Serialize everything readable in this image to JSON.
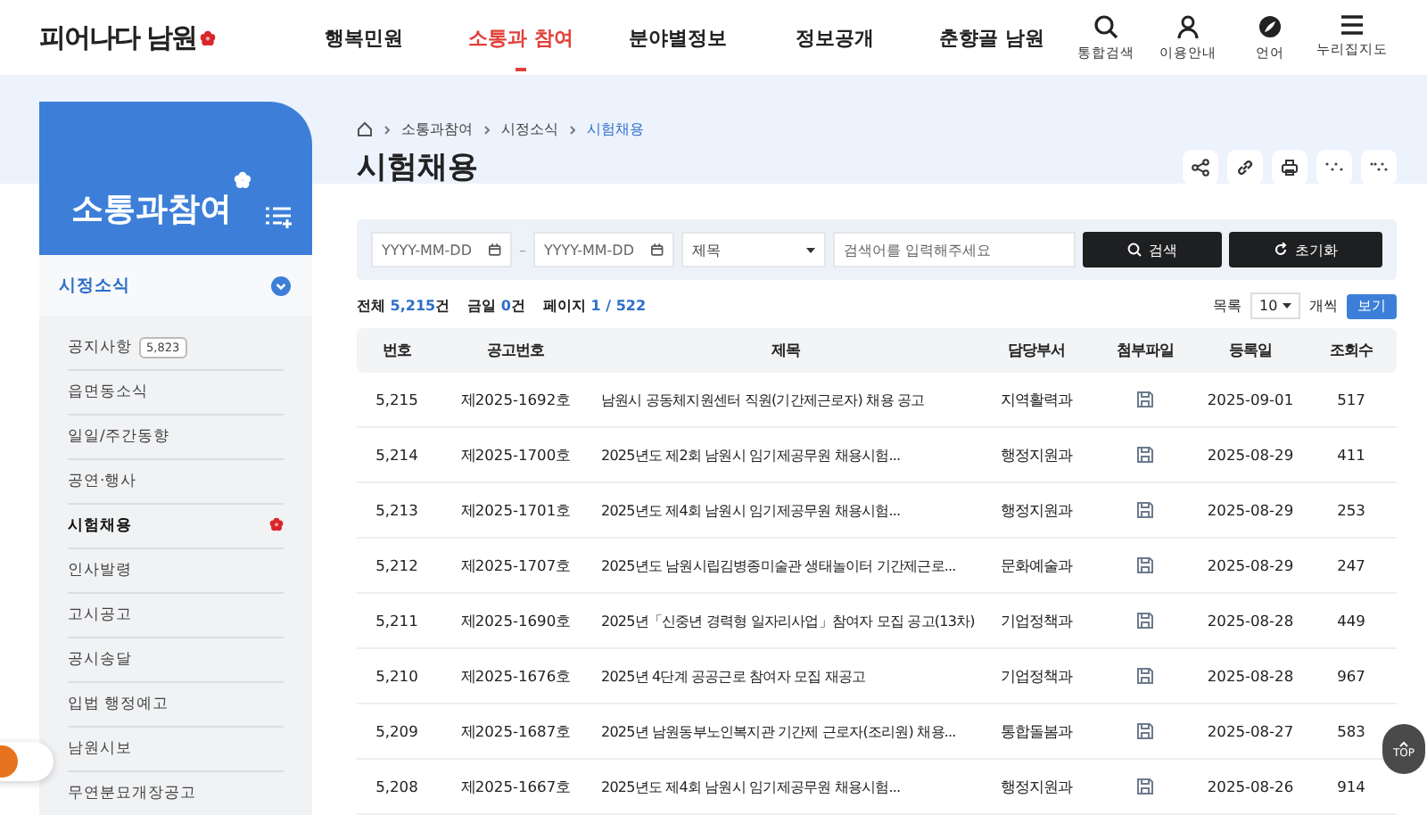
{
  "header": {
    "logo": "피어나다 남원",
    "nav": [
      {
        "label": "행복민원",
        "selected": false
      },
      {
        "label": "소통과 참여",
        "selected": true
      },
      {
        "label": "분야별정보",
        "selected": false
      },
      {
        "label": "정보공개",
        "selected": false
      },
      {
        "label": "춘향골 남원",
        "selected": false
      }
    ],
    "utilities": [
      {
        "label": "통합검색",
        "kind": "search"
      },
      {
        "label": "이용안내",
        "kind": "user"
      },
      {
        "label": "언어",
        "kind": "globe"
      },
      {
        "label": "누리집지도",
        "kind": "menu"
      }
    ]
  },
  "sidebar": {
    "title": "소통과참여",
    "section": {
      "label": "시정소식",
      "expanded": true
    },
    "items": [
      {
        "label": "공지사항",
        "badge": "5,823",
        "selected": false
      },
      {
        "label": "읍면동소식",
        "selected": false
      },
      {
        "label": "일일/주간동향",
        "selected": false
      },
      {
        "label": "공연·행사",
        "selected": false
      },
      {
        "label": "시험채용",
        "selected": true
      },
      {
        "label": "인사발령",
        "selected": false
      },
      {
        "label": "고시공고",
        "selected": false
      },
      {
        "label": "공시송달",
        "selected": false
      },
      {
        "label": "입법 행정예고",
        "selected": false
      },
      {
        "label": "남원시보",
        "selected": false
      },
      {
        "label": "무연분묘개장공고",
        "selected": false
      }
    ]
  },
  "breadcrumb": [
    "소통과참여",
    "시정소식",
    "시험채용"
  ],
  "page_title": "시험채용",
  "search": {
    "date_from": {
      "placeholder": "YYYY-MM-DD"
    },
    "range_separator": "–",
    "date_to": {
      "placeholder": "YYYY-MM-DD"
    },
    "field": "제목",
    "keyword": {
      "placeholder": "검색어를 입력해주세요"
    },
    "buttons": [
      {
        "label": "검색",
        "kind": "search"
      },
      {
        "label": "초기화",
        "kind": "reset"
      }
    ]
  },
  "summary": [
    {
      "label": "전체",
      "value": "5,215",
      "unit": "건"
    },
    {
      "label": "금일",
      "value": "0",
      "unit": "건"
    },
    {
      "label": "페이지",
      "value": "1 / 522"
    }
  ],
  "page_size": {
    "label": "목록",
    "value": "10",
    "unit": "개씩",
    "button": "보기"
  },
  "table": {
    "columns": [
      "번호",
      "공고번호",
      "제목",
      "담당부서",
      "첨부파일",
      "등록일",
      "조회수"
    ],
    "rows": [
      {
        "no": "5,215",
        "notice_no": "제2025-1692호",
        "title": "남원시 공동체지원센터 직원(기간제근로자) 채용 공고",
        "department": "지역활력과",
        "attachment": true,
        "date": "2025-09-01",
        "views": "517"
      },
      {
        "no": "5,214",
        "notice_no": "제2025-1700호",
        "title": "2025년도 제2회 남원시 임기제공무원 채용시험...",
        "department": "행정지원과",
        "attachment": true,
        "date": "2025-08-29",
        "views": "411"
      },
      {
        "no": "5,213",
        "notice_no": "제2025-1701호",
        "title": "2025년도 제4회 남원시 임기제공무원 채용시험...",
        "department": "행정지원과",
        "attachment": true,
        "date": "2025-08-29",
        "views": "253"
      },
      {
        "no": "5,212",
        "notice_no": "제2025-1707호",
        "title": "2025년도 남원시립김병종미술관 생태놀이터 기간제근로...",
        "department": "문화예술과",
        "attachment": true,
        "date": "2025-08-29",
        "views": "247"
      },
      {
        "no": "5,211",
        "notice_no": "제2025-1690호",
        "title": "2025년「신중년 경력형 일자리사업」참여자 모집 공고(13차)",
        "department": "기업정책과",
        "attachment": true,
        "date": "2025-08-28",
        "views": "449"
      },
      {
        "no": "5,210",
        "notice_no": "제2025-1676호",
        "title": "2025년 4단계 공공근로 참여자 모집 재공고",
        "department": "기업정책과",
        "attachment": true,
        "date": "2025-08-28",
        "views": "967"
      },
      {
        "no": "5,209",
        "notice_no": "제2025-1687호",
        "title": "2025년 남원동부노인복지관 기간제 근로자(조리원) 채용...",
        "department": "통합돌봄과",
        "attachment": true,
        "date": "2025-08-27",
        "views": "583"
      },
      {
        "no": "5,208",
        "notice_no": "제2025-1667호",
        "title": "2025년도 제4회 남원시 임기제공무원 채용시험...",
        "department": "행정지원과",
        "attachment": true,
        "date": "2025-08-26",
        "views": "914"
      }
    ]
  },
  "top_button": "TOP"
}
